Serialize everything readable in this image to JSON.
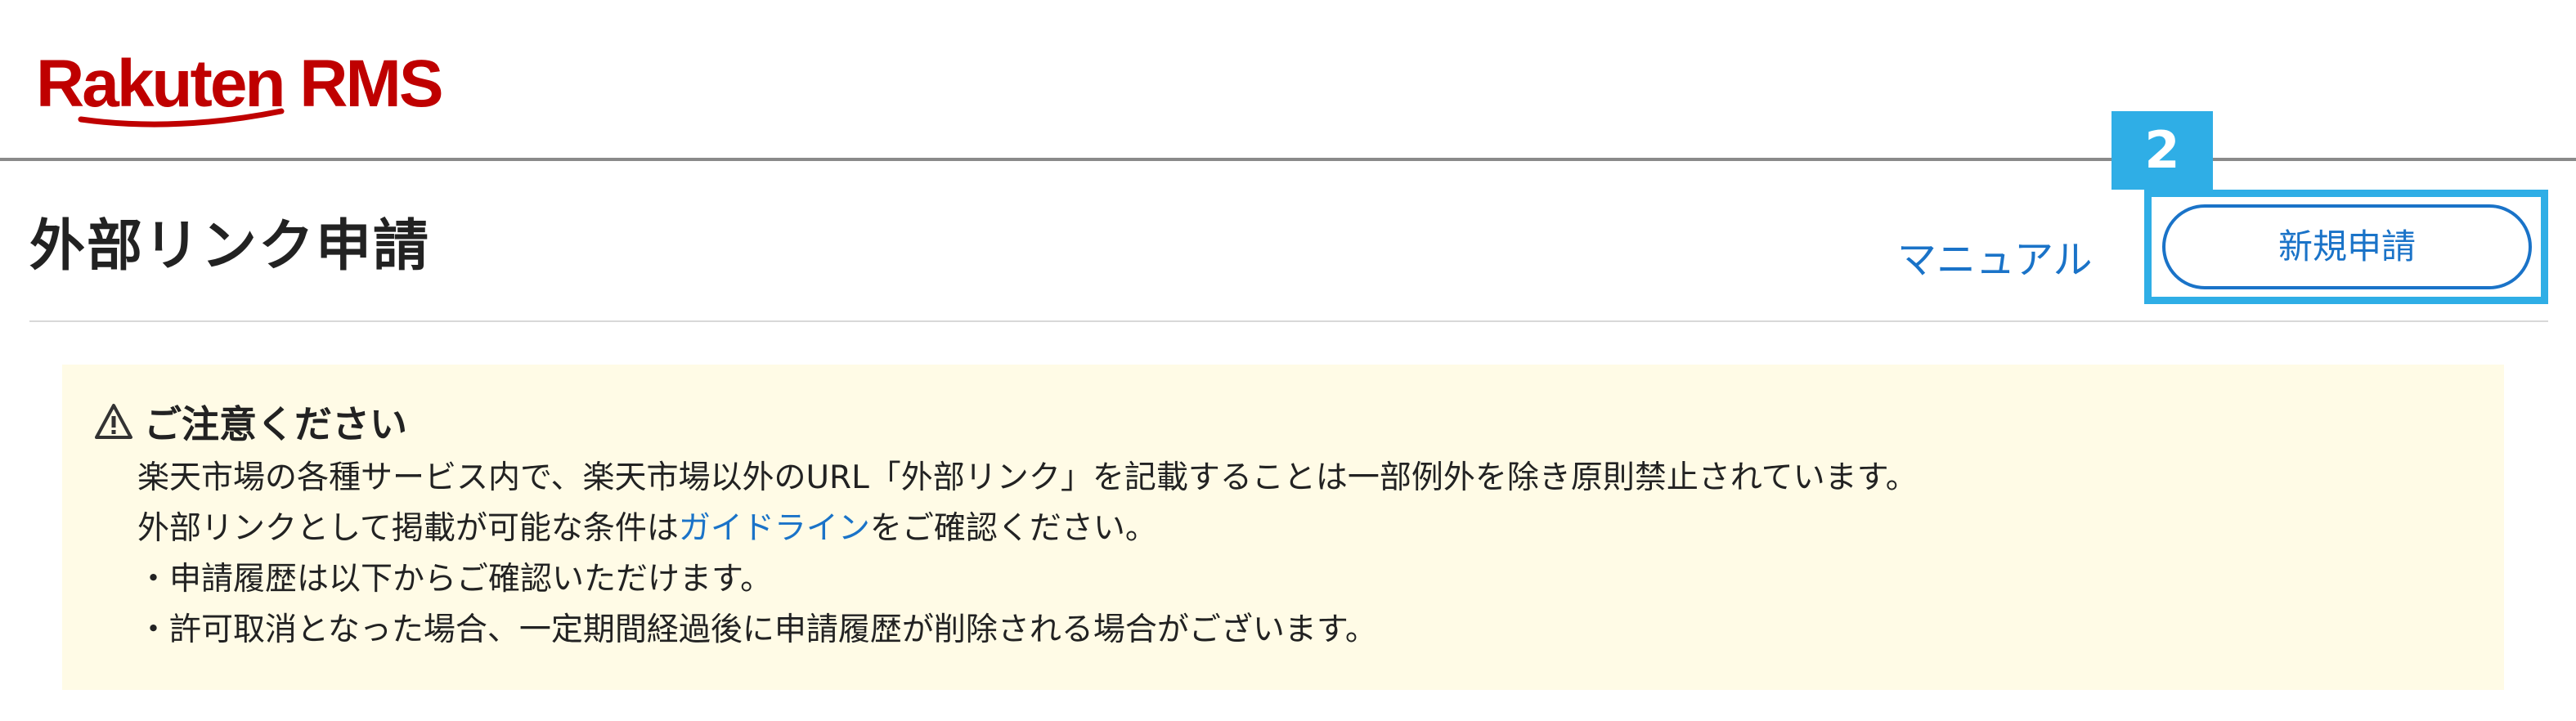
{
  "header": {
    "logo_text": "Rakuten RMS",
    "brand_color": "#bf0000"
  },
  "page": {
    "title": "外部リンク申請",
    "manual_link": "マニュアル",
    "new_application_button": "新規申請"
  },
  "annotation": {
    "step_number": "2",
    "color": "#2faee6"
  },
  "notice": {
    "icon": "warning-triangle-icon",
    "title": "ご注意ください",
    "line1": "楽天市場の各種サービス内で、楽天市場以外のURL「外部リンク」を記載することは一部例外を除き原則禁止されています。",
    "line2_before": "外部リンクとして掲載が可能な条件は",
    "line2_link": "ガイドライン",
    "line2_after": "をご確認ください。",
    "line3": "・申請履歴は以下からご確認いただけます。",
    "line4": "・許可取消となった場合、一定期間経過後に申請履歴が削除される場合がございます。",
    "background_color": "#fffbe6"
  },
  "colors": {
    "link": "#1a73c8",
    "text": "#222222",
    "header_rule": "#8a8a8a"
  }
}
